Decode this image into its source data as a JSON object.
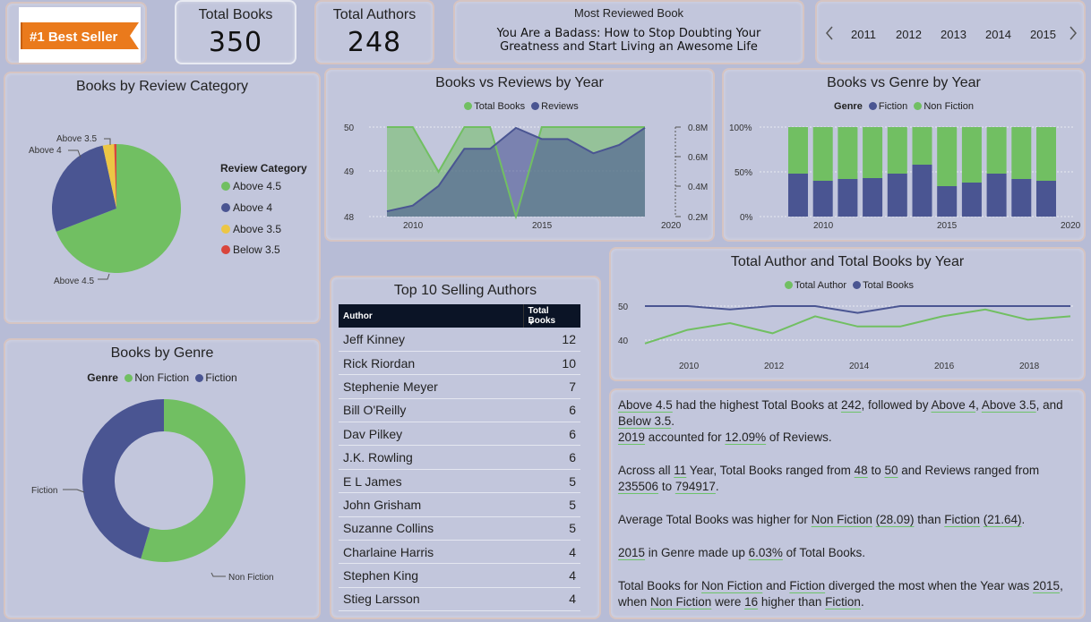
{
  "logo": {
    "text": "#1 Best Seller",
    "color": "#ea7a1c"
  },
  "kpis": {
    "total_books": {
      "label": "Total Books",
      "value": "350"
    },
    "total_authors": {
      "label": "Total Authors",
      "value": "248"
    },
    "most_reviewed": {
      "label": "Most Reviewed Book",
      "line1": "You Are a Badass: How to Stop Doubting Your",
      "line2": "Greatness and Start Living an Awesome Life"
    }
  },
  "year_slicer": {
    "years": [
      "2011",
      "2012",
      "2013",
      "2014",
      "2015"
    ]
  },
  "colors": {
    "green": "#71bf62",
    "navy": "#4a5592",
    "yellow": "#ecc645",
    "red": "#d9453c"
  },
  "review_category": {
    "title": "Books by Review Category",
    "legend_title": "Review Category",
    "legend": [
      "Above 4.5",
      "Above 4",
      "Above 3.5",
      "Below 3.5"
    ],
    "labels": {
      "above35": "Above 3.5",
      "above4": "Above 4",
      "above45": "Above 4.5"
    }
  },
  "books_reviews": {
    "title": "Books vs Reviews by Year",
    "legend": [
      "Total Books",
      "Reviews"
    ],
    "y_left": [
      "50",
      "49",
      "48"
    ],
    "y_right": [
      "0.8M",
      "0.6M",
      "0.4M",
      "0.2M"
    ],
    "x_ticks": [
      "2010",
      "2015",
      "2020"
    ]
  },
  "books_genre": {
    "title": "Books vs Genre by Year",
    "legend_title": "Genre",
    "legend": [
      "Fiction",
      "Non Fiction"
    ],
    "y_ticks": [
      "100%",
      "50%",
      "0%"
    ],
    "x_ticks": [
      "2010",
      "2015",
      "2020"
    ]
  },
  "top_authors": {
    "title": "Top 10 Selling Authors",
    "col_author": "Author",
    "col_books": "Total Books",
    "rows": [
      {
        "author": "Jeff Kinney",
        "books": "12"
      },
      {
        "author": "Rick Riordan",
        "books": "10"
      },
      {
        "author": "Stephenie Meyer",
        "books": "7"
      },
      {
        "author": "Bill O'Reilly",
        "books": "6"
      },
      {
        "author": "Dav Pilkey",
        "books": "6"
      },
      {
        "author": "J.K. Rowling",
        "books": "6"
      },
      {
        "author": "E L James",
        "books": "5"
      },
      {
        "author": "John Grisham",
        "books": "5"
      },
      {
        "author": "Suzanne Collins",
        "books": "5"
      },
      {
        "author": "Charlaine Harris",
        "books": "4"
      },
      {
        "author": "Stephen King",
        "books": "4"
      },
      {
        "author": "Stieg Larsson",
        "books": "4"
      }
    ]
  },
  "author_books": {
    "title": "Total Author and Total Books by Year",
    "legend": [
      "Total Author",
      "Total Books"
    ],
    "y_ticks": [
      "50",
      "40"
    ],
    "x_ticks": [
      "2010",
      "2012",
      "2014",
      "2016",
      "2018"
    ]
  },
  "genre_donut": {
    "title": "Books by Genre",
    "legend_title": "Genre",
    "legend": [
      "Non Fiction",
      "Fiction"
    ],
    "labels": {
      "fiction": "Fiction",
      "nonfiction": "Non Fiction"
    }
  },
  "insights": {
    "p1": [
      {
        "t": "Above 4.5",
        "u": true
      },
      {
        "t": " had the highest Total Books at "
      },
      {
        "t": "242",
        "u": true
      },
      {
        "t": ", followed by "
      },
      {
        "t": "Above 4",
        "u": true
      },
      {
        "t": ", "
      },
      {
        "t": "Above 3.5",
        "u": true
      },
      {
        "t": ", and "
      },
      {
        "t": "Below 3.5",
        "u": true
      },
      {
        "t": "."
      },
      {
        "br": true
      },
      {
        "t": "2019",
        "u": true
      },
      {
        "t": " accounted for "
      },
      {
        "t": "12.09%",
        "u": true
      },
      {
        "t": " of Reviews."
      }
    ],
    "p2": [
      {
        "t": "Across all "
      },
      {
        "t": "11",
        "u": true
      },
      {
        "t": " Year, Total Books ranged from "
      },
      {
        "t": "48",
        "u": true
      },
      {
        "t": " to "
      },
      {
        "t": "50",
        "u": true
      },
      {
        "t": " and Reviews ranged from "
      },
      {
        "t": "235506",
        "u": true
      },
      {
        "t": " to "
      },
      {
        "t": "794917",
        "u": true
      },
      {
        "t": "."
      }
    ],
    "p3": [
      {
        "t": "Average Total Books was higher for "
      },
      {
        "t": "Non Fiction",
        "u": true
      },
      {
        "t": " "
      },
      {
        "t": "(28.09)",
        "u": true
      },
      {
        "t": " than "
      },
      {
        "t": "Fiction",
        "u": true
      },
      {
        "t": " "
      },
      {
        "t": "(21.64)",
        "u": true
      },
      {
        "t": "."
      }
    ],
    "p4": [
      {
        "t": "2015",
        "u": true
      },
      {
        "t": " in Genre  made up "
      },
      {
        "t": "6.03%",
        "u": true
      },
      {
        "t": " of Total Books."
      }
    ],
    "p5": [
      {
        "t": "Total Books for "
      },
      {
        "t": "Non Fiction",
        "u": true
      },
      {
        "t": " and "
      },
      {
        "t": "Fiction",
        "u": true
      },
      {
        "t": " diverged the most when the Year was "
      },
      {
        "t": "2015",
        "u": true
      },
      {
        "t": ", when "
      },
      {
        "t": "Non Fiction",
        "u": true
      },
      {
        "t": " were "
      },
      {
        "t": "16",
        "u": true
      },
      {
        "t": " higher than "
      },
      {
        "t": "Fiction",
        "u": true
      },
      {
        "t": "."
      }
    ]
  },
  "chart_data": [
    {
      "type": "pie",
      "title": "Books by Review Category",
      "categories": [
        "Above 4.5",
        "Above 4",
        "Above 3.5",
        "Below 3.5"
      ],
      "values": [
        242,
        96,
        10,
        2
      ]
    },
    {
      "type": "area",
      "title": "Books vs Reviews by Year",
      "x": [
        2009,
        2010,
        2011,
        2012,
        2013,
        2014,
        2015,
        2016,
        2017,
        2018,
        2019
      ],
      "series": [
        {
          "name": "Total Books",
          "values": [
            50,
            50,
            49,
            50,
            50,
            48,
            50,
            50,
            50,
            50,
            50
          ]
        },
        {
          "name": "Reviews",
          "values": [
            235506,
            273981,
            405041,
            654546,
            654546,
            794917,
            720040,
            720040,
            624178,
            680000,
            794917
          ]
        }
      ],
      "ylim_left": [
        48,
        50
      ],
      "ylim_right": [
        0,
        800000
      ]
    },
    {
      "type": "bar",
      "title": "Books vs Genre by Year",
      "categories": [
        "2009",
        "2010",
        "2011",
        "2012",
        "2013",
        "2014",
        "2015",
        "2016",
        "2017",
        "2018",
        "2019"
      ],
      "series": [
        {
          "name": "Fiction",
          "values": [
            0.48,
            0.4,
            0.42,
            0.43,
            0.48,
            0.58,
            0.34,
            0.38,
            0.48,
            0.42,
            0.4
          ]
        },
        {
          "name": "Non Fiction",
          "values": [
            0.52,
            0.6,
            0.58,
            0.57,
            0.52,
            0.42,
            0.66,
            0.62,
            0.52,
            0.58,
            0.6
          ]
        }
      ],
      "ylim": [
        0,
        1
      ]
    },
    {
      "type": "pie",
      "title": "Books by Genre",
      "categories": [
        "Non Fiction",
        "Fiction"
      ],
      "values": [
        191,
        159
      ]
    },
    {
      "type": "line",
      "title": "Total Author and Total Books by Year",
      "x": [
        2009,
        2010,
        2011,
        2012,
        2013,
        2014,
        2015,
        2016,
        2017,
        2018,
        2019
      ],
      "series": [
        {
          "name": "Total Author",
          "values": [
            39,
            43,
            45,
            42,
            47,
            44,
            44,
            47,
            49,
            46,
            47
          ]
        },
        {
          "name": "Total Books",
          "values": [
            50,
            50,
            49,
            50,
            50,
            48,
            50,
            50,
            50,
            50,
            50
          ]
        }
      ],
      "ylim": [
        36,
        52
      ]
    }
  ]
}
